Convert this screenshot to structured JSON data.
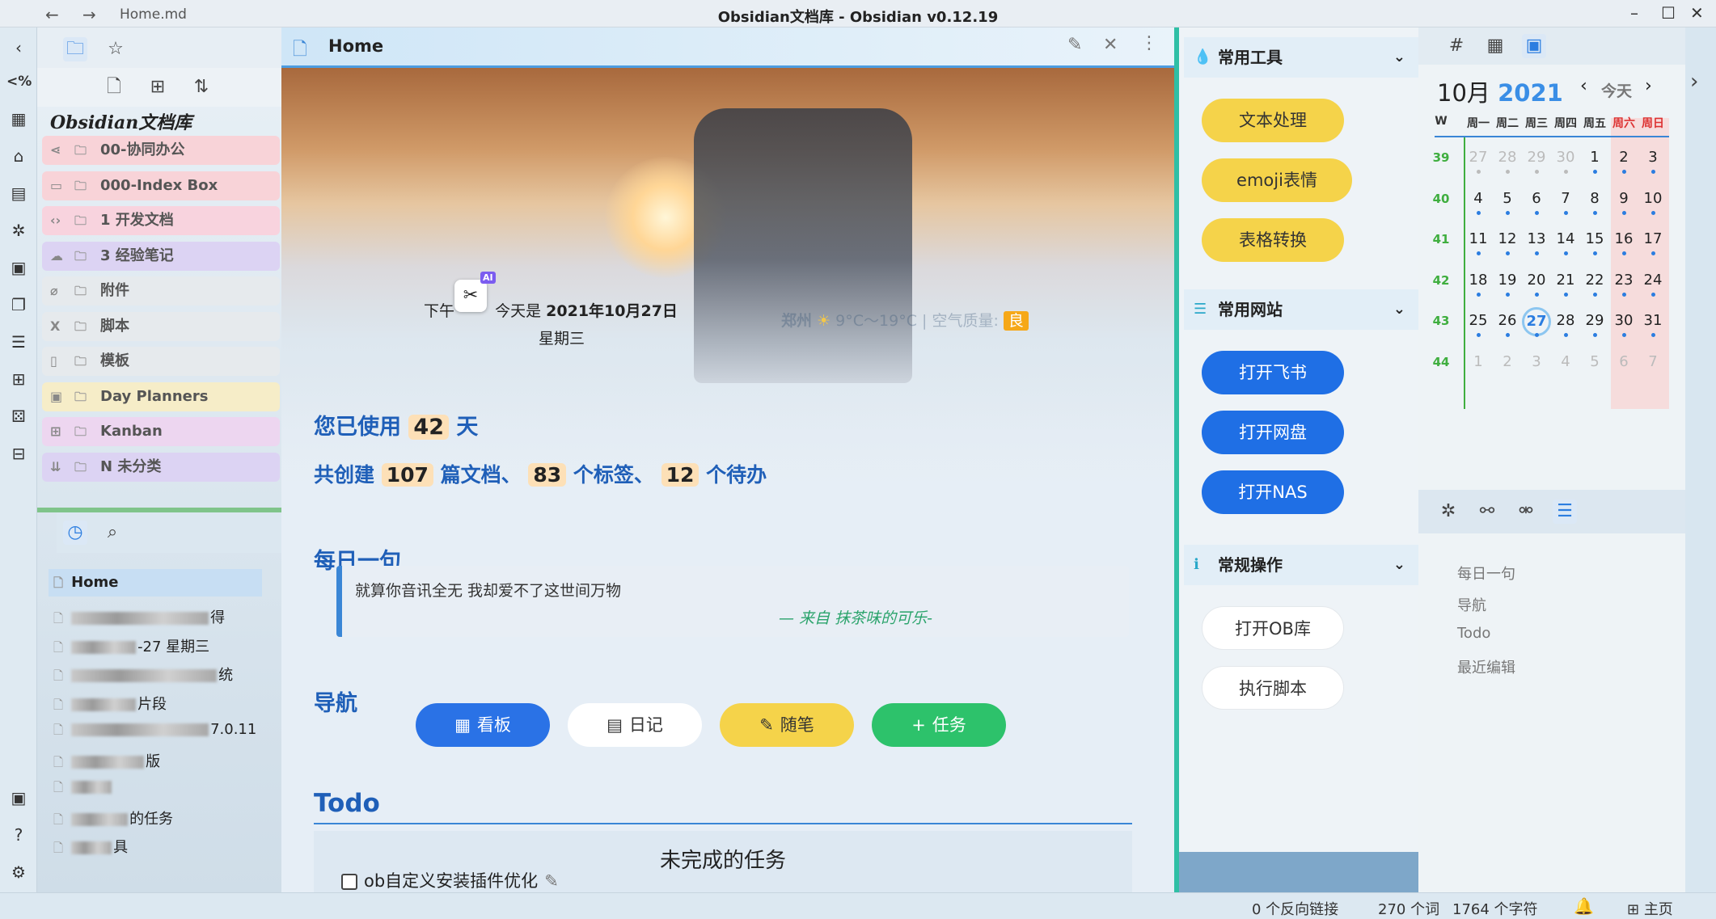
{
  "window": {
    "file": "Home.md",
    "title": "Obsidian文档库 - Obsidian v0.12.19",
    "min": "–",
    "max": "☐",
    "close": "✕",
    "back": "←",
    "forward": "→"
  },
  "vault": {
    "name": "Obsidian文档库"
  },
  "folders": [
    {
      "label": "00-协同办公",
      "icon": "share-icon",
      "color": "#f8d3d8"
    },
    {
      "label": "000-Index Box",
      "icon": "index-icon",
      "color": "#f8d3d8"
    },
    {
      "label": "1 开发文档",
      "icon": "code-icon",
      "color": "#f8d3de"
    },
    {
      "label": "3 经验笔记",
      "icon": "cloud-icon",
      "color": "#dcd3f3"
    },
    {
      "label": "附件",
      "icon": "paperclip-icon",
      "color": "#e6eaed"
    },
    {
      "label": "脚本",
      "icon": "subscript-icon",
      "color": "#e6eaed"
    },
    {
      "label": "模板",
      "icon": "template-icon",
      "color": "#e6eaed"
    },
    {
      "label": "Day Planners",
      "icon": "calendar-icon",
      "color": "#f6edc8"
    },
    {
      "label": "Kanban",
      "icon": "kanban-icon",
      "color": "#edd6f0"
    },
    {
      "label": "N 未分类",
      "icon": "sort-icon",
      "color": "#dcd3f3"
    }
  ],
  "recent": {
    "items": [
      {
        "prefix": "",
        "suffix": "Home"
      },
      {
        "prefix": "",
        "suffix": "得"
      },
      {
        "prefix": "",
        "suffix": "-27 星期三"
      },
      {
        "prefix": "",
        "suffix": "统"
      },
      {
        "prefix": "",
        "suffix": "片段"
      },
      {
        "prefix": "",
        "suffix": "7.0.11"
      },
      {
        "prefix": "",
        "suffix": "版"
      },
      {
        "prefix": "",
        "suffix": ""
      },
      {
        "prefix": "",
        "suffix": "的任务"
      },
      {
        "prefix": "",
        "suffix": "具"
      }
    ]
  },
  "note": {
    "tab_title": "Home",
    "greeting_prefix": "下午",
    "date_label": "今天是",
    "date": "2021年10月27日",
    "weekday": "星期三",
    "weather": {
      "city": "郑州",
      "temp": "9°C～19°C",
      "aq_label": "空气质量:",
      "aq": "良"
    },
    "ai_badge": "AI",
    "usage": {
      "prefix": "您已使用",
      "days": "42",
      "suffix": "天"
    },
    "created": {
      "prefix": "共创建",
      "docs": "107",
      "docs_label": "篇文档、",
      "tags": "83",
      "tags_label": "个标签、",
      "todos": "12",
      "todos_label": "个待办"
    },
    "quote_heading": "每日一句",
    "quote": "就算你音讯全无 我却爱不了这世间万物",
    "quote_source": "— 来自 抹茶味的可乐-",
    "nav_heading": "导航",
    "nav_buttons": [
      {
        "label": "看板",
        "icon": "board-icon"
      },
      {
        "label": "日记",
        "icon": "diary-icon"
      },
      {
        "label": "随笔",
        "icon": "note-icon"
      },
      {
        "label": "任务",
        "icon": "plus-icon"
      }
    ],
    "todo_heading": "Todo",
    "todo_box_title": "未完成的任务",
    "todo_items": [
      "ob自定义安装插件优化"
    ]
  },
  "tools": {
    "sections": [
      {
        "title": "常用工具",
        "buttons": [
          "文本处理",
          "emoji表情",
          "表格转换"
        ]
      },
      {
        "title": "常用网站",
        "buttons": [
          "打开飞书",
          "打开网盘",
          "打开NAS"
        ]
      },
      {
        "title": "常规操作",
        "buttons": [
          "打开OB库",
          "执行脚本"
        ]
      }
    ]
  },
  "calendar": {
    "month": "10月",
    "year": "2021",
    "today_label": "今天",
    "headers": [
      "W",
      "周一",
      "周二",
      "周三",
      "周四",
      "周五",
      "周六",
      "周日"
    ],
    "weeks": [
      {
        "wk": "39",
        "days": [
          "27",
          "28",
          "29",
          "30",
          "1",
          "2",
          "3"
        ]
      },
      {
        "wk": "40",
        "days": [
          "4",
          "5",
          "6",
          "7",
          "8",
          "9",
          "10"
        ]
      },
      {
        "wk": "41",
        "days": [
          "11",
          "12",
          "13",
          "14",
          "15",
          "16",
          "17"
        ]
      },
      {
        "wk": "42",
        "days": [
          "18",
          "19",
          "20",
          "21",
          "22",
          "23",
          "24"
        ]
      },
      {
        "wk": "43",
        "days": [
          "25",
          "26",
          "27",
          "28",
          "29",
          "30",
          "31"
        ]
      },
      {
        "wk": "44",
        "days": [
          "1",
          "2",
          "3",
          "4",
          "5",
          "6",
          "7"
        ]
      }
    ],
    "today": "27"
  },
  "outline": {
    "items": [
      "每日一句",
      "导航",
      "Todo",
      "最近编辑"
    ]
  },
  "status": {
    "backlinks": "0 个反向链接",
    "words": "270 个词",
    "chars": "1764 个字符",
    "home": "主页"
  },
  "colors": {
    "accent": "#2b7de0",
    "tool_yellow": "#f5d34a",
    "tool_blue": "#1f6fe5",
    "green_btn": "#2dc26b"
  }
}
